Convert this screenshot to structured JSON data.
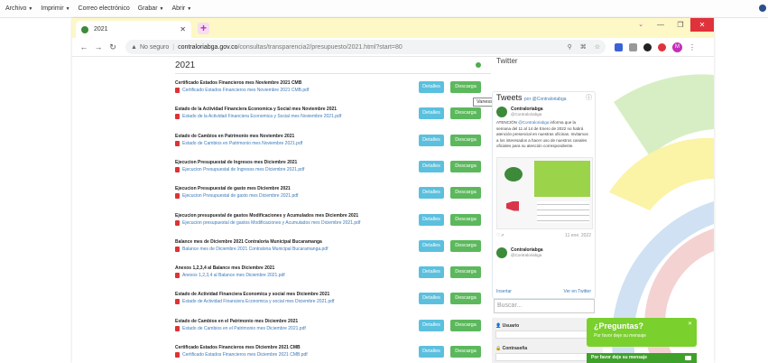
{
  "app_menu": [
    {
      "label": "Archivo"
    },
    {
      "label": "Imprimir"
    },
    {
      "label": "Correo electrónico"
    },
    {
      "label": "Grabar"
    },
    {
      "label": "Abrir"
    }
  ],
  "browser": {
    "tab_title": "2021",
    "url_warning": "No seguro",
    "url_host": "contraloriabga.gov.co",
    "url_path": "/consultas/transparencia2/presupuesto/2021.html?start=80",
    "avatar_letter": "M"
  },
  "list": {
    "heading": "2021",
    "details_label": "Detalles",
    "download_label": "Descarga",
    "rows": [
      {
        "title": "Certificado Estados Financieros mes Noviembre 2021 CMB",
        "file": "Certificado Estados Financieros mes Noviembre 2021 CMB.pdf"
      },
      {
        "title": "Estado de la Actividad Financiera Economica y Social mes Noviembre 2021",
        "file": "Estado de la Actividad Financiera Economica y Social mes Noviembre 2021.pdf"
      },
      {
        "title": "Estado de Cambios en Patrimonio mes Noviembre 2021",
        "file": "Estado de Cambios en Patrimonio mes Noviembre 2021.pdf"
      },
      {
        "title": "Ejecucion Presupuestal de Ingresos mes Diciembre 2021",
        "file": "Ejecucion Presupuestal de Ingresos mes Diciembre 2021.pdf"
      },
      {
        "title": "Ejecucion Presupuestal de gasto mes Diciembre 2021",
        "file": "Ejecucion Presupuestal de gasto mes Diciembre 2021.pdf"
      },
      {
        "title": "Ejecucion presupuestal de gastos Modificaciones y Acumulados mes Diciembre 2021",
        "file": "Ejecucion presupuestal de gastos Modificaciones y Acumulados mes Diciembre 2021.pdf"
      },
      {
        "title": "Balance mes de Diciembre 2021 Contraloria Municipal Bucaramanga",
        "file": "Balance mes de Diciembre 2021 Contraloria Municipal Bucaramanga.pdf"
      },
      {
        "title": "Anexos 1,2,3,4 al Balance mes Diciembre 2021",
        "file": "Anexos 1,2,3,4 al Balance mes Diciembre 2021.pdf"
      },
      {
        "title": "Estado de Actividad Financiera Economica y social mes Diciembre 2021",
        "file": "Estado de Actividad Financiera Economica y social mes Diciembre 2021.pdf"
      },
      {
        "title": "Estado de Cambios en el Patrimonio mes Diciembre 2021",
        "file": "Estado de Cambios en el Patrimonio mes Diciembre 2021.pdf"
      },
      {
        "title": "Certificado Estados Financieros mes Diciembre 2021 CMB",
        "file": "Certificado Estados Financieros mes Diciembre 2021 CMB.pdf"
      }
    ]
  },
  "tooltip": "Vanessa Flórez Contraloria",
  "twitter": {
    "section_label": "Twitter",
    "header": "Tweets",
    "header_by": "por @Contraloriabga",
    "author_name": "Contraloriabga",
    "author_handle": "@Contraloriabga",
    "tweet_prefix": "ATENCIÓN",
    "tweet_mention": "@Contraloriabga",
    "tweet_body": "informa que la semana del 11 al 14 de Enero de 2022 no habrá atención presencial en nuestras oficinas. Invitamos a los interesados a hacer uso de nuestros canales oficiales para su atención correspondiente.",
    "tweet_date": "11 ene. 2022",
    "second_author": "Contraloriabga",
    "second_handle": "@Contraloriabga",
    "embed_label": "Insertar",
    "view_label": "Ver en Twitter"
  },
  "search": {
    "placeholder": "Buscar..."
  },
  "login": {
    "user_label": "Usuario",
    "password_label": "Contraseña"
  },
  "chat": {
    "title": "¿Preguntas?",
    "subtitle": "Por favor deje su mensaje",
    "bar_label": "Por favor deje su mensaje"
  }
}
